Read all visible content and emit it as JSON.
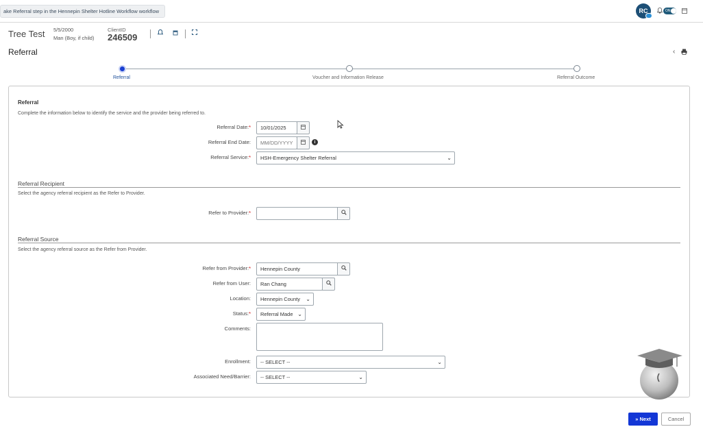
{
  "banner": {
    "text": "ake Referral step in the Hennepin Shelter Hotline Workflow workflow"
  },
  "user": {
    "initials": "RC",
    "toggle_label": "ON"
  },
  "client": {
    "name": "Tree Test",
    "dob": "5/5/2000",
    "gender": "Man (Boy, if child)",
    "id_label": "ClientID",
    "id_value": "246509"
  },
  "page": {
    "title": "Referral"
  },
  "stepper": {
    "steps": [
      {
        "label": "Referral",
        "active": true
      },
      {
        "label": "Voucher and Information Release",
        "active": false
      },
      {
        "label": "Referral Outcome",
        "active": false
      }
    ]
  },
  "referral": {
    "title": "Referral",
    "description": "Complete the information below to identify the service and the provider being referred to.",
    "date_label": "Referral Date:",
    "date_value": "10/01/2025",
    "end_date_label": "Referral End Date:",
    "end_date_placeholder": "MM/DD/YYYY",
    "service_label": "Referral Service:",
    "service_value": "HSH-Emergency Shelter Referral"
  },
  "recipient": {
    "title": "Referral Recipient",
    "description": "Select the agency referral recipient as the Refer to Provider.",
    "provider_label": "Refer to Provider:",
    "provider_value": ""
  },
  "source": {
    "title": "Referral Source",
    "description": "Select the agency referral source as the Refer from Provider.",
    "provider_label": "Refer from Provider:",
    "provider_value": "Hennepin County",
    "user_label": "Refer from User:",
    "user_value": "Ran Chang",
    "location_label": "Location:",
    "location_value": "Hennepin County",
    "status_label": "Status:",
    "status_value": "Referral Made",
    "comments_label": "Comments:",
    "enrollment_label": "Enrollment:",
    "enrollment_value": "-- SELECT --",
    "need_label": "Associated Need/Barrier:",
    "need_value": "-- SELECT --"
  },
  "buttons": {
    "next": "» Next",
    "cancel": "Cancel"
  },
  "required_mark": "*",
  "icons": {
    "calendar": "calendar-icon",
    "search": "search-icon",
    "info": "info-icon",
    "bell": "bell-icon",
    "print": "print-icon",
    "back": "chevron-left-icon",
    "expand": "expand-icon"
  },
  "colors": {
    "primary": "#1337d6",
    "avatar": "#1d4f76",
    "step_active": "#1a3fd1"
  }
}
